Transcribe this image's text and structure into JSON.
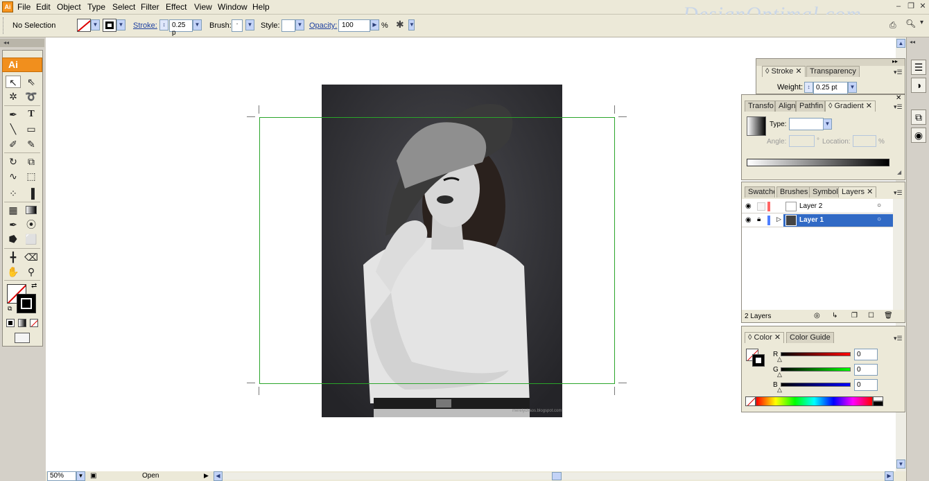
{
  "menubar": {
    "app_icon": "Ai",
    "items": [
      "File",
      "Edit",
      "Object",
      "Type",
      "Select",
      "Filter",
      "Effect",
      "View",
      "Window",
      "Help"
    ],
    "watermark": "DesignOptimal.com"
  },
  "controlbar": {
    "selection_status": "No Selection",
    "stroke_label": "Stroke:",
    "stroke_value": "0.25 p",
    "brush_label": "Brush:",
    "brush_value": "·",
    "style_label": "Style:",
    "opacity_label": "Opacity:",
    "opacity_value": "100",
    "percent": "%"
  },
  "tools": {
    "logo": "Ai",
    "type_tool": "T"
  },
  "stroke_panel": {
    "tabs": [
      "Stroke",
      "Transparency"
    ],
    "weight_label": "Weight:",
    "weight_value": "0.25 pt"
  },
  "gradient_panel": {
    "tabs": [
      "Transfo",
      "Align",
      "Pathfin",
      "Gradient"
    ],
    "type_label": "Type:",
    "angle_label": "Angle:",
    "location_label": "Location:",
    "pct": "%",
    "deg": "°"
  },
  "layers_panel": {
    "tabs": [
      "Swatche",
      "Brushes",
      "Symbols",
      "Layers"
    ],
    "layers": [
      {
        "name": "Layer 2",
        "color": "#ff6666",
        "selected": false
      },
      {
        "name": "Layer 1",
        "color": "#4f7fff",
        "selected": true
      }
    ],
    "count_label": "2 Layers"
  },
  "color_panel": {
    "tabs": [
      "Color",
      "Color Guide"
    ],
    "channels": [
      {
        "label": "R",
        "value": "0",
        "gradient": "linear-gradient(90deg,#000,#ff0000)"
      },
      {
        "label": "G",
        "value": "0",
        "gradient": "linear-gradient(90deg,#000,#00ff00)"
      },
      {
        "label": "B",
        "value": "0",
        "gradient": "linear-gradient(90deg,#000,#0000ff)"
      }
    ]
  },
  "statusbar": {
    "zoom": "50%",
    "status": "Open"
  },
  "photo": {
    "credit": "merelychaos.blogspot.com"
  }
}
